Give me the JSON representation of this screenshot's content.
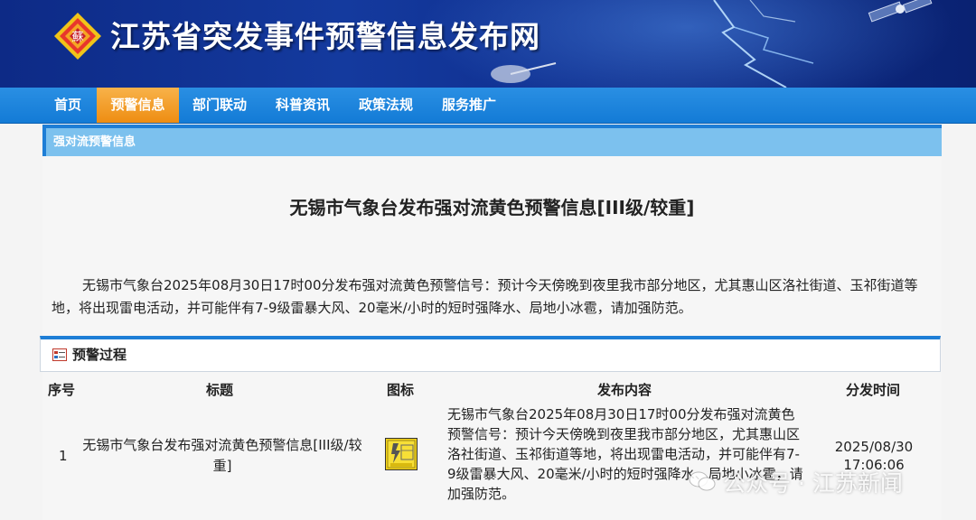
{
  "site": {
    "title": "江苏省突发事件预警信息发布网",
    "logo_text": "蘇"
  },
  "nav": {
    "items": [
      {
        "label": "首页"
      },
      {
        "label": "预警信息",
        "active": true
      },
      {
        "label": "部门联动"
      },
      {
        "label": "科普资讯"
      },
      {
        "label": "政策法规"
      },
      {
        "label": "服务推广"
      }
    ]
  },
  "section": {
    "title": "强对流预警信息"
  },
  "article": {
    "title": "无锡市气象台发布强对流黄色预警信息[III级/较重]",
    "body": "无锡市气象台2025年08月30日17时00分发布强对流黄色预警信号：预计今天傍晚到夜里我市部分地区，尤其惠山区洛社街道、玉祁街道等地，将出现雷电活动，并可能伴有7-9级雷暴大风、20毫米/小时的短时强降水、局地小冰雹，请加强防范。"
  },
  "process": {
    "title": "预警过程",
    "headers": {
      "index": "序号",
      "title": "标题",
      "icon": "图标",
      "content": "发布内容",
      "time": "分发时间"
    },
    "rows": [
      {
        "index": "1",
        "title": "无锡市气象台发布强对流黄色预警信息[III级/较重]",
        "icon": "yellow-thunderstorm-warning-icon",
        "content": "无锡市气象台2025年08月30日17时00分发布强对流黄色预警信号：预计今天傍晚到夜里我市部分地区，尤其惠山区洛社街道、玉祁街道等地，将出现雷电活动，并可能伴有7-9级雷暴大风、20毫米/小时的短时强降水、局地小冰雹，请加强防范。",
        "time": "2025/08/30 17:06:06"
      }
    ]
  },
  "watermark": {
    "text": "公众号 · 江苏新闻"
  },
  "colors": {
    "nav_blue": "#1e7ed6",
    "nav_active": "#f0951e",
    "section_bar": "#7cc1ee",
    "header_blue": "#0f2f8f"
  }
}
